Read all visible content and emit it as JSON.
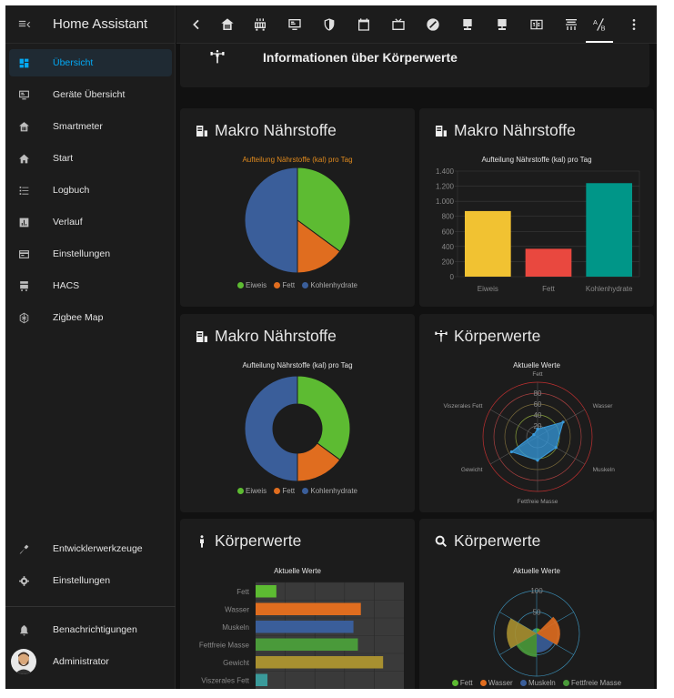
{
  "app": {
    "title": "Home Assistant"
  },
  "sidebar": {
    "items": [
      {
        "label": "Übersicht",
        "icon": "dashboard-icon",
        "active": true
      },
      {
        "label": "Geräte Übersicht",
        "icon": "monitor-icon"
      },
      {
        "label": "Smartmeter",
        "icon": "home-building-icon"
      },
      {
        "label": "Start",
        "icon": "home-icon"
      },
      {
        "label": "Logbuch",
        "icon": "list-icon"
      },
      {
        "label": "Verlauf",
        "icon": "chart-box-icon"
      },
      {
        "label": "Einstellungen",
        "icon": "credit-card-icon"
      },
      {
        "label": "HACS",
        "icon": "hacs-icon"
      },
      {
        "label": "Zigbee Map",
        "icon": "zigbee-icon"
      }
    ],
    "bottom": [
      {
        "label": "Entwicklerwerkzeuge",
        "icon": "hammer-icon"
      },
      {
        "label": "Einstellungen",
        "icon": "cog-icon"
      },
      {
        "label": "Benachrichtigungen",
        "icon": "bell-icon"
      },
      {
        "label": "Administrator",
        "icon": "avatar"
      }
    ]
  },
  "info": {
    "text": "Informationen über Körperwerte"
  },
  "cards": {
    "pie": {
      "title": "Makro Nährstoffe",
      "subtitle": "Aufteilung Nährstoffe (kal) pro Tag"
    },
    "bar": {
      "title": "Makro Nährstoffe",
      "subtitle": "Aufteilung Nährstoffe (kal) pro Tag"
    },
    "donut": {
      "title": "Makro Nährstoffe",
      "subtitle": "Aufteilung Nährstoffe (kal) pro Tag"
    },
    "radar": {
      "title": "Körperwerte",
      "subtitle": "Aktuelle Werte"
    },
    "hbar": {
      "title": "Körperwerte",
      "subtitle": "Aktuelle Werte"
    },
    "polar": {
      "title": "Körperwerte",
      "subtitle": "Aktuelle Werte"
    }
  },
  "legend_macro": [
    "Eiweis",
    "Fett",
    "Kohlenhydrate"
  ],
  "legend_polar": [
    "Fett",
    "Wasser",
    "Muskeln",
    "Fettfreie Masse"
  ],
  "colors": {
    "green": "#5dbb32",
    "orange": "#e06d1f",
    "blue": "#3a5e9a",
    "yellow": "#f1c232",
    "red": "#e9483f",
    "teal": "#009688",
    "accent": "#03a9f4"
  },
  "chart_data": [
    {
      "type": "pie",
      "title": "Aufteilung Nährstoffe (kal) pro Tag",
      "categories": [
        "Eiweis",
        "Fett",
        "Kohlenhydrate"
      ],
      "values": [
        870,
        370,
        1240
      ]
    },
    {
      "type": "bar",
      "title": "Aufteilung Nährstoffe (kal) pro Tag",
      "categories": [
        "Eiweis",
        "Fett",
        "Kohlenhydrate"
      ],
      "values": [
        870,
        370,
        1240
      ],
      "ylim": [
        0,
        1400
      ],
      "yticks": [
        "0",
        "200",
        "400",
        "600",
        "800",
        "1.000",
        "1.200",
        "1.400"
      ]
    },
    {
      "type": "pie",
      "title": "Aufteilung Nährstoffe (kal) pro Tag",
      "categories": [
        "Eiweis",
        "Fett",
        "Kohlenhydrate"
      ],
      "values": [
        870,
        370,
        1240
      ]
    },
    {
      "type": "radar",
      "title": "Aktuelle Werte",
      "categories": [
        "Fett",
        "Wasser",
        "Muskeln",
        "Fettfreie Masse",
        "Gewicht",
        "Viszerales Fett"
      ],
      "values": [
        14,
        54,
        39,
        43,
        55,
        8
      ],
      "ylim": [
        0,
        100
      ],
      "rticks": [
        "20",
        "40",
        "60",
        "80"
      ]
    },
    {
      "type": "bar",
      "orientation": "horizontal",
      "title": "Aktuelle Werte",
      "categories": [
        "Fett",
        "Wasser",
        "Muskeln",
        "Fettfreie Masse",
        "Gewicht",
        "Viszerales Fett"
      ],
      "values": [
        14,
        71,
        66,
        69,
        86,
        8
      ],
      "xlim": [
        0,
        100
      ]
    },
    {
      "type": "polar",
      "title": "Aktuelle Werte",
      "categories": [
        "Fett",
        "Wasser",
        "Muskeln",
        "Fettfreie Masse"
      ],
      "rticks": [
        "50",
        "100"
      ]
    }
  ]
}
